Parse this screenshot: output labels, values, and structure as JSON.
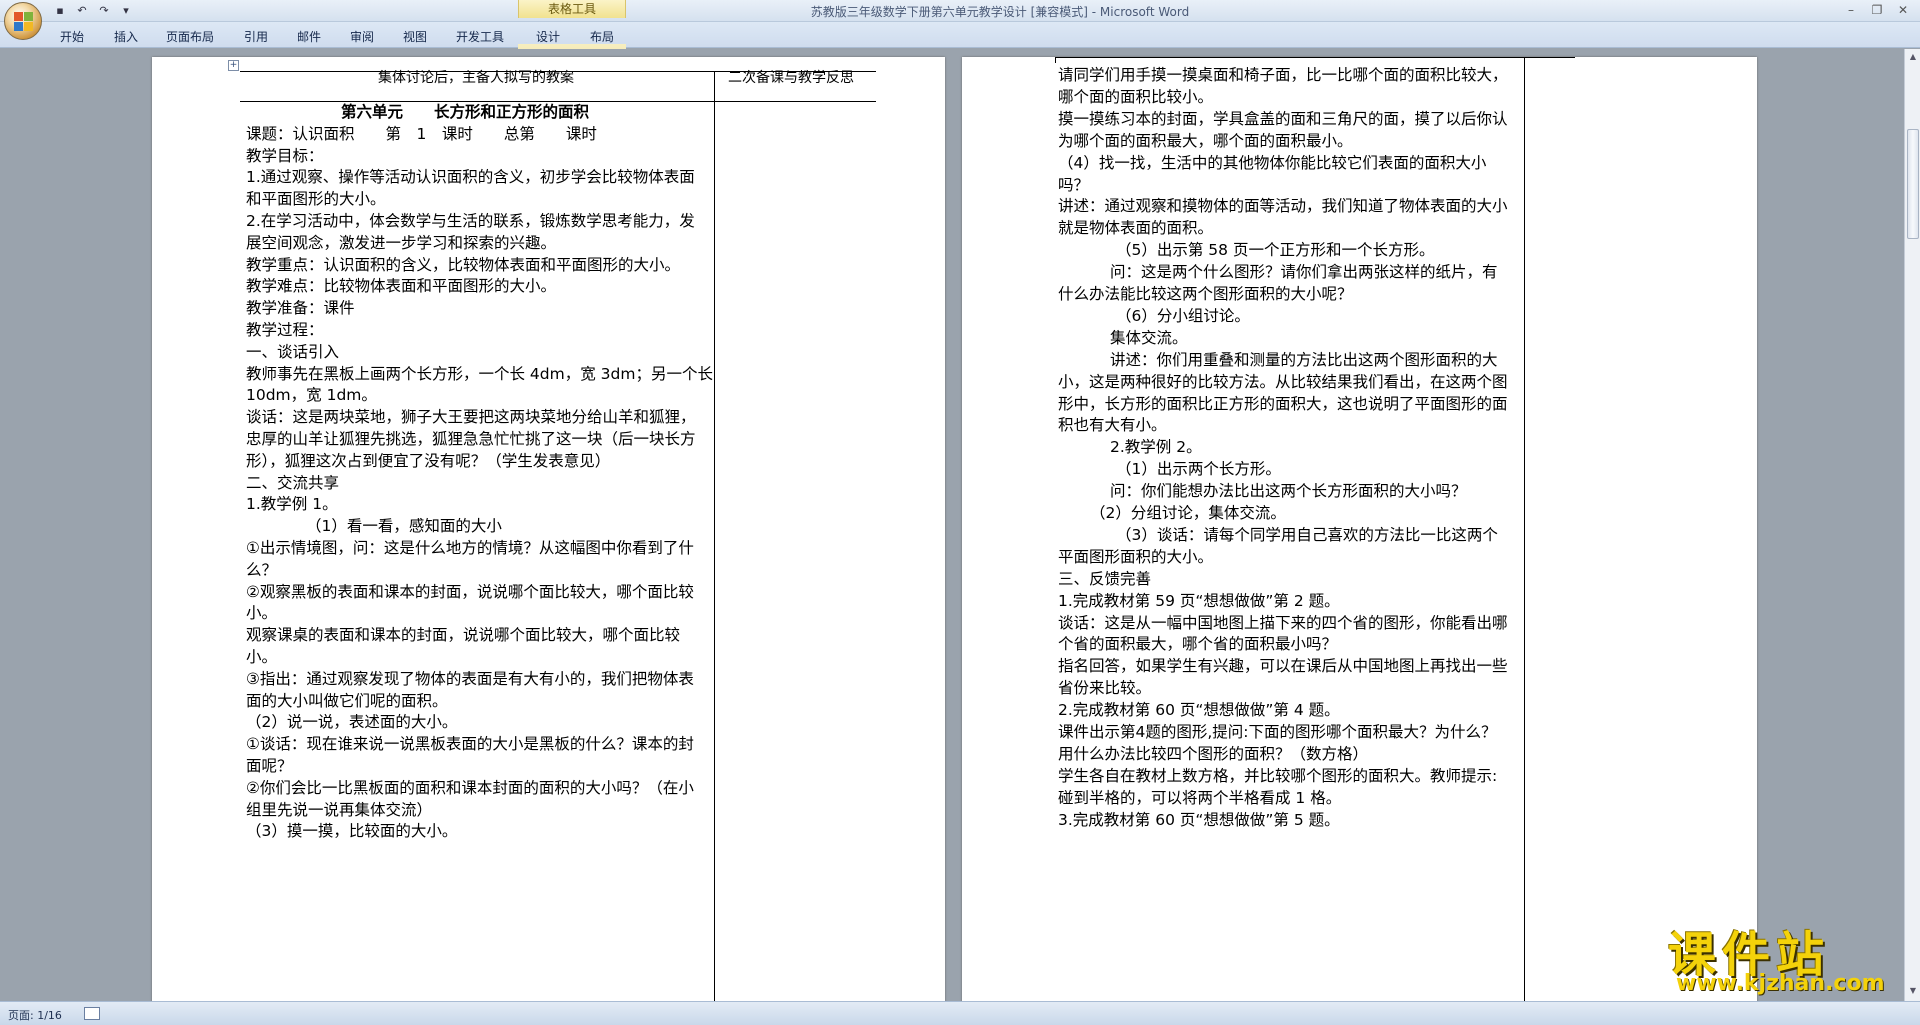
{
  "window": {
    "title": "苏教版三年级数学下册第六单元教学设计 [兼容模式] - Microsoft Word",
    "contextual_group": "表格工具"
  },
  "ribbon": {
    "tabs": [
      "开始",
      "插入",
      "页面布局",
      "引用",
      "邮件",
      "审阅",
      "视图",
      "开发工具",
      "设计",
      "布局"
    ]
  },
  "status": {
    "page": "页面: 1/16"
  },
  "page1": {
    "header_left": "集体讨论后，主备人拟写的教案",
    "header_right": "二次备课与教学反思",
    "lines": [
      "第六单元　　长方形和正方形的面积",
      "课题：认识面积　　第　1　课时　　总第　　课时",
      "教学目标：",
      "1.通过观察、操作等活动认识面积的含义，初步学会比较物体表面",
      "和平面图形的大小。",
      "2.在学习活动中，体会数学与生活的联系，锻炼数学思考能力，发",
      "展空间观念，激发进一步学习和探索的兴趣。",
      "教学重点：认识面积的含义，比较物体表面和平面图形的大小。",
      "教学难点：比较物体表面和平面图形的大小。",
      "教学准备：课件",
      "教学过程：",
      "一、谈话引入",
      "教师事先在黑板上画两个长方形，一个长 4dm，宽 3dm；另一个长",
      "10dm，宽 1dm。",
      "谈话：这是两块菜地，狮子大王要把这两块菜地分给山羊和狐狸，",
      "忠厚的山羊让狐狸先挑选，狐狸急急忙忙挑了这一块（后一块长方",
      "形），狐狸这次占到便宜了没有呢？（学生发表意见）",
      "二、交流共享",
      "1.教学例 1。",
      "（1）看一看，感知面的大小",
      "①出示情境图，问：这是什么地方的情境？从这幅图中你看到了什",
      "么？",
      "②观察黑板的表面和课本的封面，说说哪个面比较大，哪个面比较",
      "小。",
      "观察课桌的表面和课本的封面，说说哪个面比较大，哪个面比较",
      "小。",
      "③指出：通过观察发现了物体的表面是有大有小的，我们把物体表",
      "面的大小叫做它们呢的面积。",
      "（2）说一说，表述面的大小。",
      "①谈话：现在谁来说一说黑板表面的大小是黑板的什么？课本的封",
      "面呢？",
      "②你们会比一比黑板面的面积和课本封面的面积的大小吗？（在小",
      "组里先说一说再集体交流）",
      "（3）摸一摸，比较面的大小。"
    ]
  },
  "page2": {
    "lines": [
      "请同学们用手摸一摸桌面和椅子面，比一比哪个面的面积比较大，",
      "哪个面的面积比较小。",
      "摸一摸练习本的封面，学具盒盖的面和三角尺的面，摸了以后你认",
      "为哪个面的面积最大，哪个面的面积最小。",
      "（4）找一找，生活中的其他物体你能比较它们表面的面积大小",
      "吗？",
      "讲述：通过观察和摸物体的面等活动，我们知道了物体表面的大小",
      "就是物体表面的面积。",
      "（5）出示第 58 页一个正方形和一个长方形。",
      "问：这是两个什么图形？请你们拿出两张这样的纸片，有",
      "什么办法能比较这两个图形面积的大小呢？",
      "（6）分小组讨论。",
      "集体交流。",
      "讲述：你们用重叠和测量的方法比出这两个图形面积的大",
      "小，这是两种很好的比较方法。从比较结果我们看出，在这两个图",
      "形中，长方形的面积比正方形的面积大，这也说明了平面图形的面",
      "积也有大有小。",
      "2.教学例 2。",
      "（1）出示两个长方形。",
      "问：你们能想办法比出这两个长方形面积的大小吗？",
      "（2）分组讨论，集体交流。",
      "（3）谈话：请每个同学用自己喜欢的方法比一比这两个",
      "平面图形面积的大小。",
      "三、反馈完善",
      "1.完成教材第 59 页“想想做做”第 2 题。",
      "谈话：这是从一幅中国地图上描下来的四个省的图形，你能看出哪",
      "个省的面积最大，哪个省的面积最小吗？",
      "指名回答，如果学生有兴趣，可以在课后从中国地图上再找出一些",
      "省份来比较。",
      "2.完成教材第 60 页“想想做做”第 4 题。",
      "课件出示第4题的图形,提问:下面的图形哪个面积最大？为什么？",
      "用什么办法比较四个图形的面积？（数方格）",
      "学生各自在教材上数方格，并比较哪个图形的面积大。教师提示:",
      "碰到半格的，可以将两个半格看成 1 格。",
      "3.完成教材第 60 页“想想做做”第 5 题。"
    ]
  },
  "watermark": {
    "cn": "课件站",
    "url": "www.kjzhan.com"
  },
  "colors": {
    "watermark": "#f4d20a",
    "workspace": "#9aa3ad"
  }
}
